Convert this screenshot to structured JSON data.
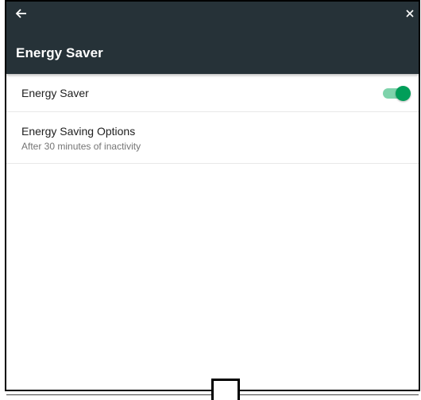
{
  "header": {
    "title": "Energy Saver",
    "back_icon": "arrow-left-icon",
    "close_icon": "close-icon"
  },
  "settings": {
    "items": [
      {
        "label": "Energy Saver",
        "toggle_on": true
      },
      {
        "label": "Energy Saving Options",
        "subtitle": "After 30 minutes of inactivity"
      }
    ]
  },
  "colors": {
    "header_bg": "#263238",
    "accent": "#009e59",
    "toggle_track": "#7ed3ab"
  },
  "navigation": {
    "home_icon": "home-square-icon"
  }
}
